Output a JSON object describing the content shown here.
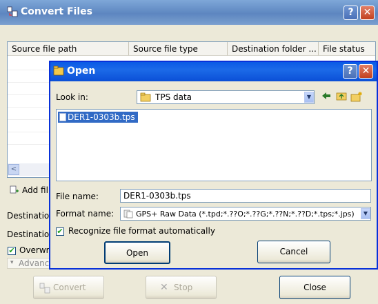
{
  "window": {
    "title": "Convert Files",
    "help_label": "?",
    "close_label": "✕"
  },
  "table": {
    "columns": [
      "Source file path",
      "Source file type",
      "Destination folder ...",
      "File status"
    ],
    "scroll_left": "<"
  },
  "side": {
    "add_files_label": "Add fil",
    "destination_label_1": "Destination",
    "destination_label_2": "Destination",
    "overwrite_label": "Overwrit",
    "advanced_label": "Advanc"
  },
  "bottom": {
    "convert_label": "Convert",
    "stop_label": "Stop",
    "close_label": "Close"
  },
  "dialog": {
    "title": "Open",
    "look_in_label": "Look in:",
    "look_in_value": "TPS data",
    "files": [
      "DER1-0303b.tps"
    ],
    "file_name_label": "File name:",
    "file_name_value": "DER1-0303b.tps",
    "format_name_label": "Format name:",
    "format_name_value": "GPS+ Raw Data (*.tpd;*.??O;*.??G;*.??N;*.??D;*.tps;*.jps)",
    "recognize_label": "Recognize file format automatically",
    "open_label": "Open",
    "cancel_label": "Cancel",
    "help_label": "?",
    "close_label": "✕"
  },
  "colors": {
    "title_bar": "#6a92cc",
    "dialog_title_bar": "#0a5ae6",
    "selection": "#316ac5"
  }
}
